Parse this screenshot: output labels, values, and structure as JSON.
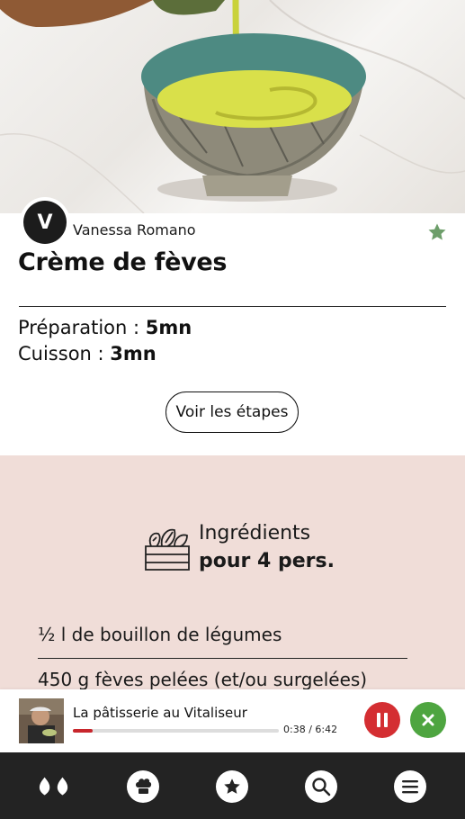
{
  "recipe": {
    "author_initial": "V",
    "author_name": "Vanessa Romano",
    "title": "Crème de fèves",
    "prep_label": "Préparation : ",
    "prep_value": "5mn",
    "cook_label": "Cuisson : ",
    "cook_value": "3mn",
    "steps_button": "Voir les étapes"
  },
  "ingredients": {
    "heading_line1": "Ingrédients",
    "heading_line2": "pour 4 pers.",
    "items": [
      "½ l de bouillon de légumes",
      "450 g fèves pelées (et/ou surgelées)"
    ]
  },
  "player": {
    "title": "La pâtisserie au Vitaliseur",
    "time": "0:38 / 6:42",
    "progress": 0.094
  },
  "nav": {
    "items": [
      "drops-icon",
      "chef-hat-icon",
      "star-icon",
      "search-icon",
      "menu-icon"
    ]
  },
  "colors": {
    "ingredients_bg": "#f0ddd8",
    "pause_red": "#d42e32",
    "close_green": "#4ea540",
    "favorite_star": "#6d9e6a",
    "nav_bg": "#232323"
  }
}
